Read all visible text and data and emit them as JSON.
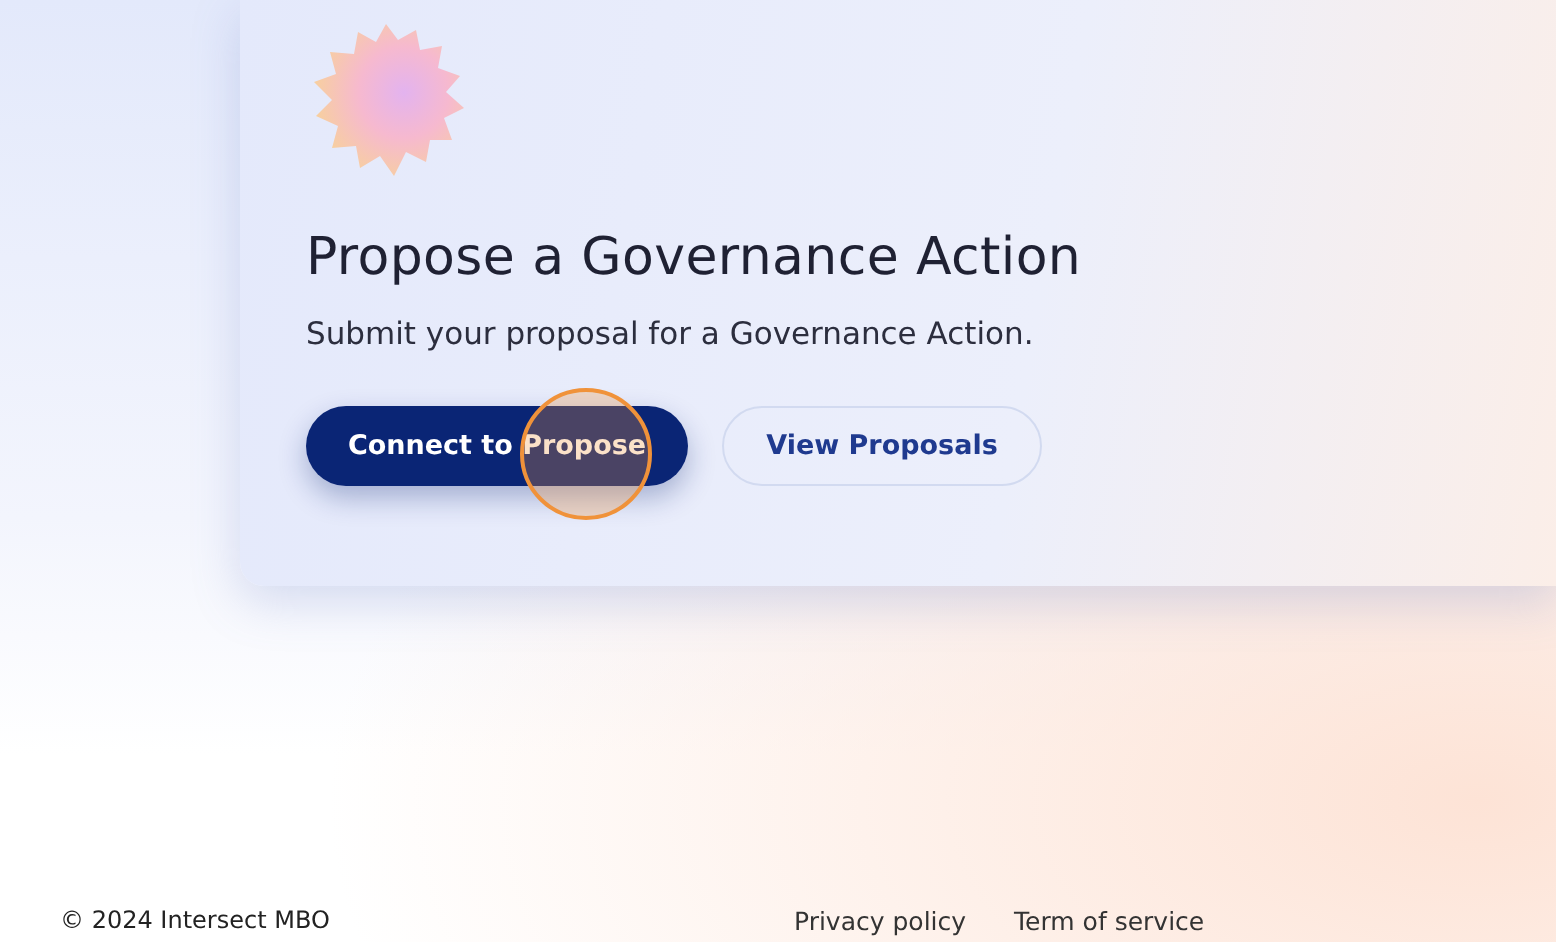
{
  "card": {
    "title": "Propose a Governance Action",
    "subtitle": "Submit your proposal for a Governance Action.",
    "buttons": [
      {
        "label": "Connect to Propose",
        "kind": "primary"
      },
      {
        "label": "View Proposals",
        "kind": "secondary"
      }
    ]
  },
  "footer": {
    "copyright": "© 2024 Intersect MBO",
    "links": [
      "Privacy policy",
      "Term of service"
    ]
  }
}
